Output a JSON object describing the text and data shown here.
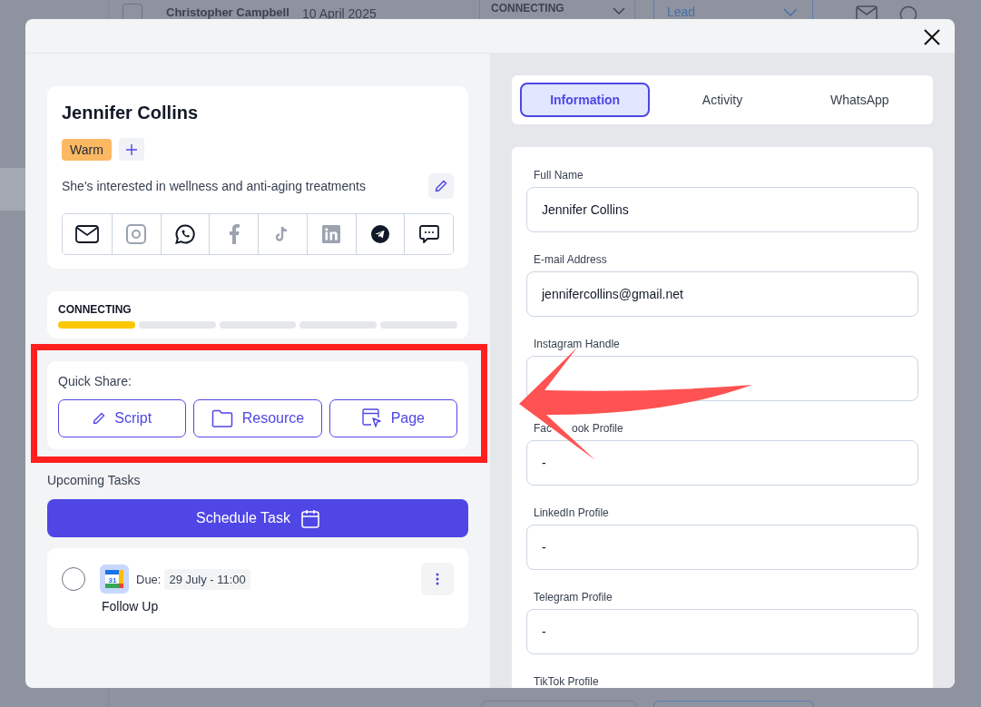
{
  "backdrop_row": {
    "checked": false,
    "name": "Christopher Campbell",
    "date": "10 April 2025",
    "stage": "CONNECTING",
    "status": "Lead"
  },
  "contact": {
    "name": "Jennifer Collins",
    "tags": [
      {
        "label": "Warm",
        "color": "#fdb863"
      }
    ],
    "note": "She's interested in wellness and anti-aging treatments"
  },
  "channels": [
    {
      "kind": "email",
      "linked": true
    },
    {
      "kind": "instagram",
      "linked": false
    },
    {
      "kind": "whatsapp",
      "linked": true
    },
    {
      "kind": "facebook",
      "linked": false
    },
    {
      "kind": "tiktok",
      "linked": false
    },
    {
      "kind": "linkedin",
      "linked": false
    },
    {
      "kind": "telegram",
      "linked": true
    },
    {
      "kind": "sms",
      "linked": true
    }
  ],
  "stage": {
    "label": "CONNECTING",
    "steps": [
      {
        "done": true
      },
      {
        "done": false
      },
      {
        "done": false
      },
      {
        "done": false
      },
      {
        "done": false
      }
    ]
  },
  "quick_share": {
    "label": "Quick Share:",
    "buttons": [
      {
        "kind": "script",
        "label": "Script"
      },
      {
        "kind": "resource",
        "label": "Resource"
      },
      {
        "kind": "page",
        "label": "Page"
      }
    ]
  },
  "tasks": {
    "title": "Upcoming Tasks",
    "schedule_button": "Schedule Task",
    "items": [
      {
        "done": false,
        "calendar_day": "31",
        "due_label": "Due:",
        "due": "29 July - 11:00",
        "title": "Follow Up"
      }
    ]
  },
  "tabs": [
    {
      "label": "Information",
      "selected": true
    },
    {
      "label": "Activity",
      "selected": false
    },
    {
      "label": "WhatsApp",
      "selected": false
    }
  ],
  "fields": [
    {
      "label": "Full Name",
      "value": "Jennifer Collins"
    },
    {
      "label": "E-mail Address",
      "value": "jennifercollins@gmail.net"
    },
    {
      "label": "Instagram Handle"
    },
    {
      "label_parts": [
        "Fac",
        "ook Profile"
      ],
      "value": "-"
    },
    {
      "label": "LinkedIn Profile",
      "value": "-"
    },
    {
      "label": "Telegram Profile",
      "value": "-"
    },
    {
      "label": "TikTok Profile"
    }
  ],
  "annotations": {
    "highlight_frame": true,
    "arrow": true
  }
}
